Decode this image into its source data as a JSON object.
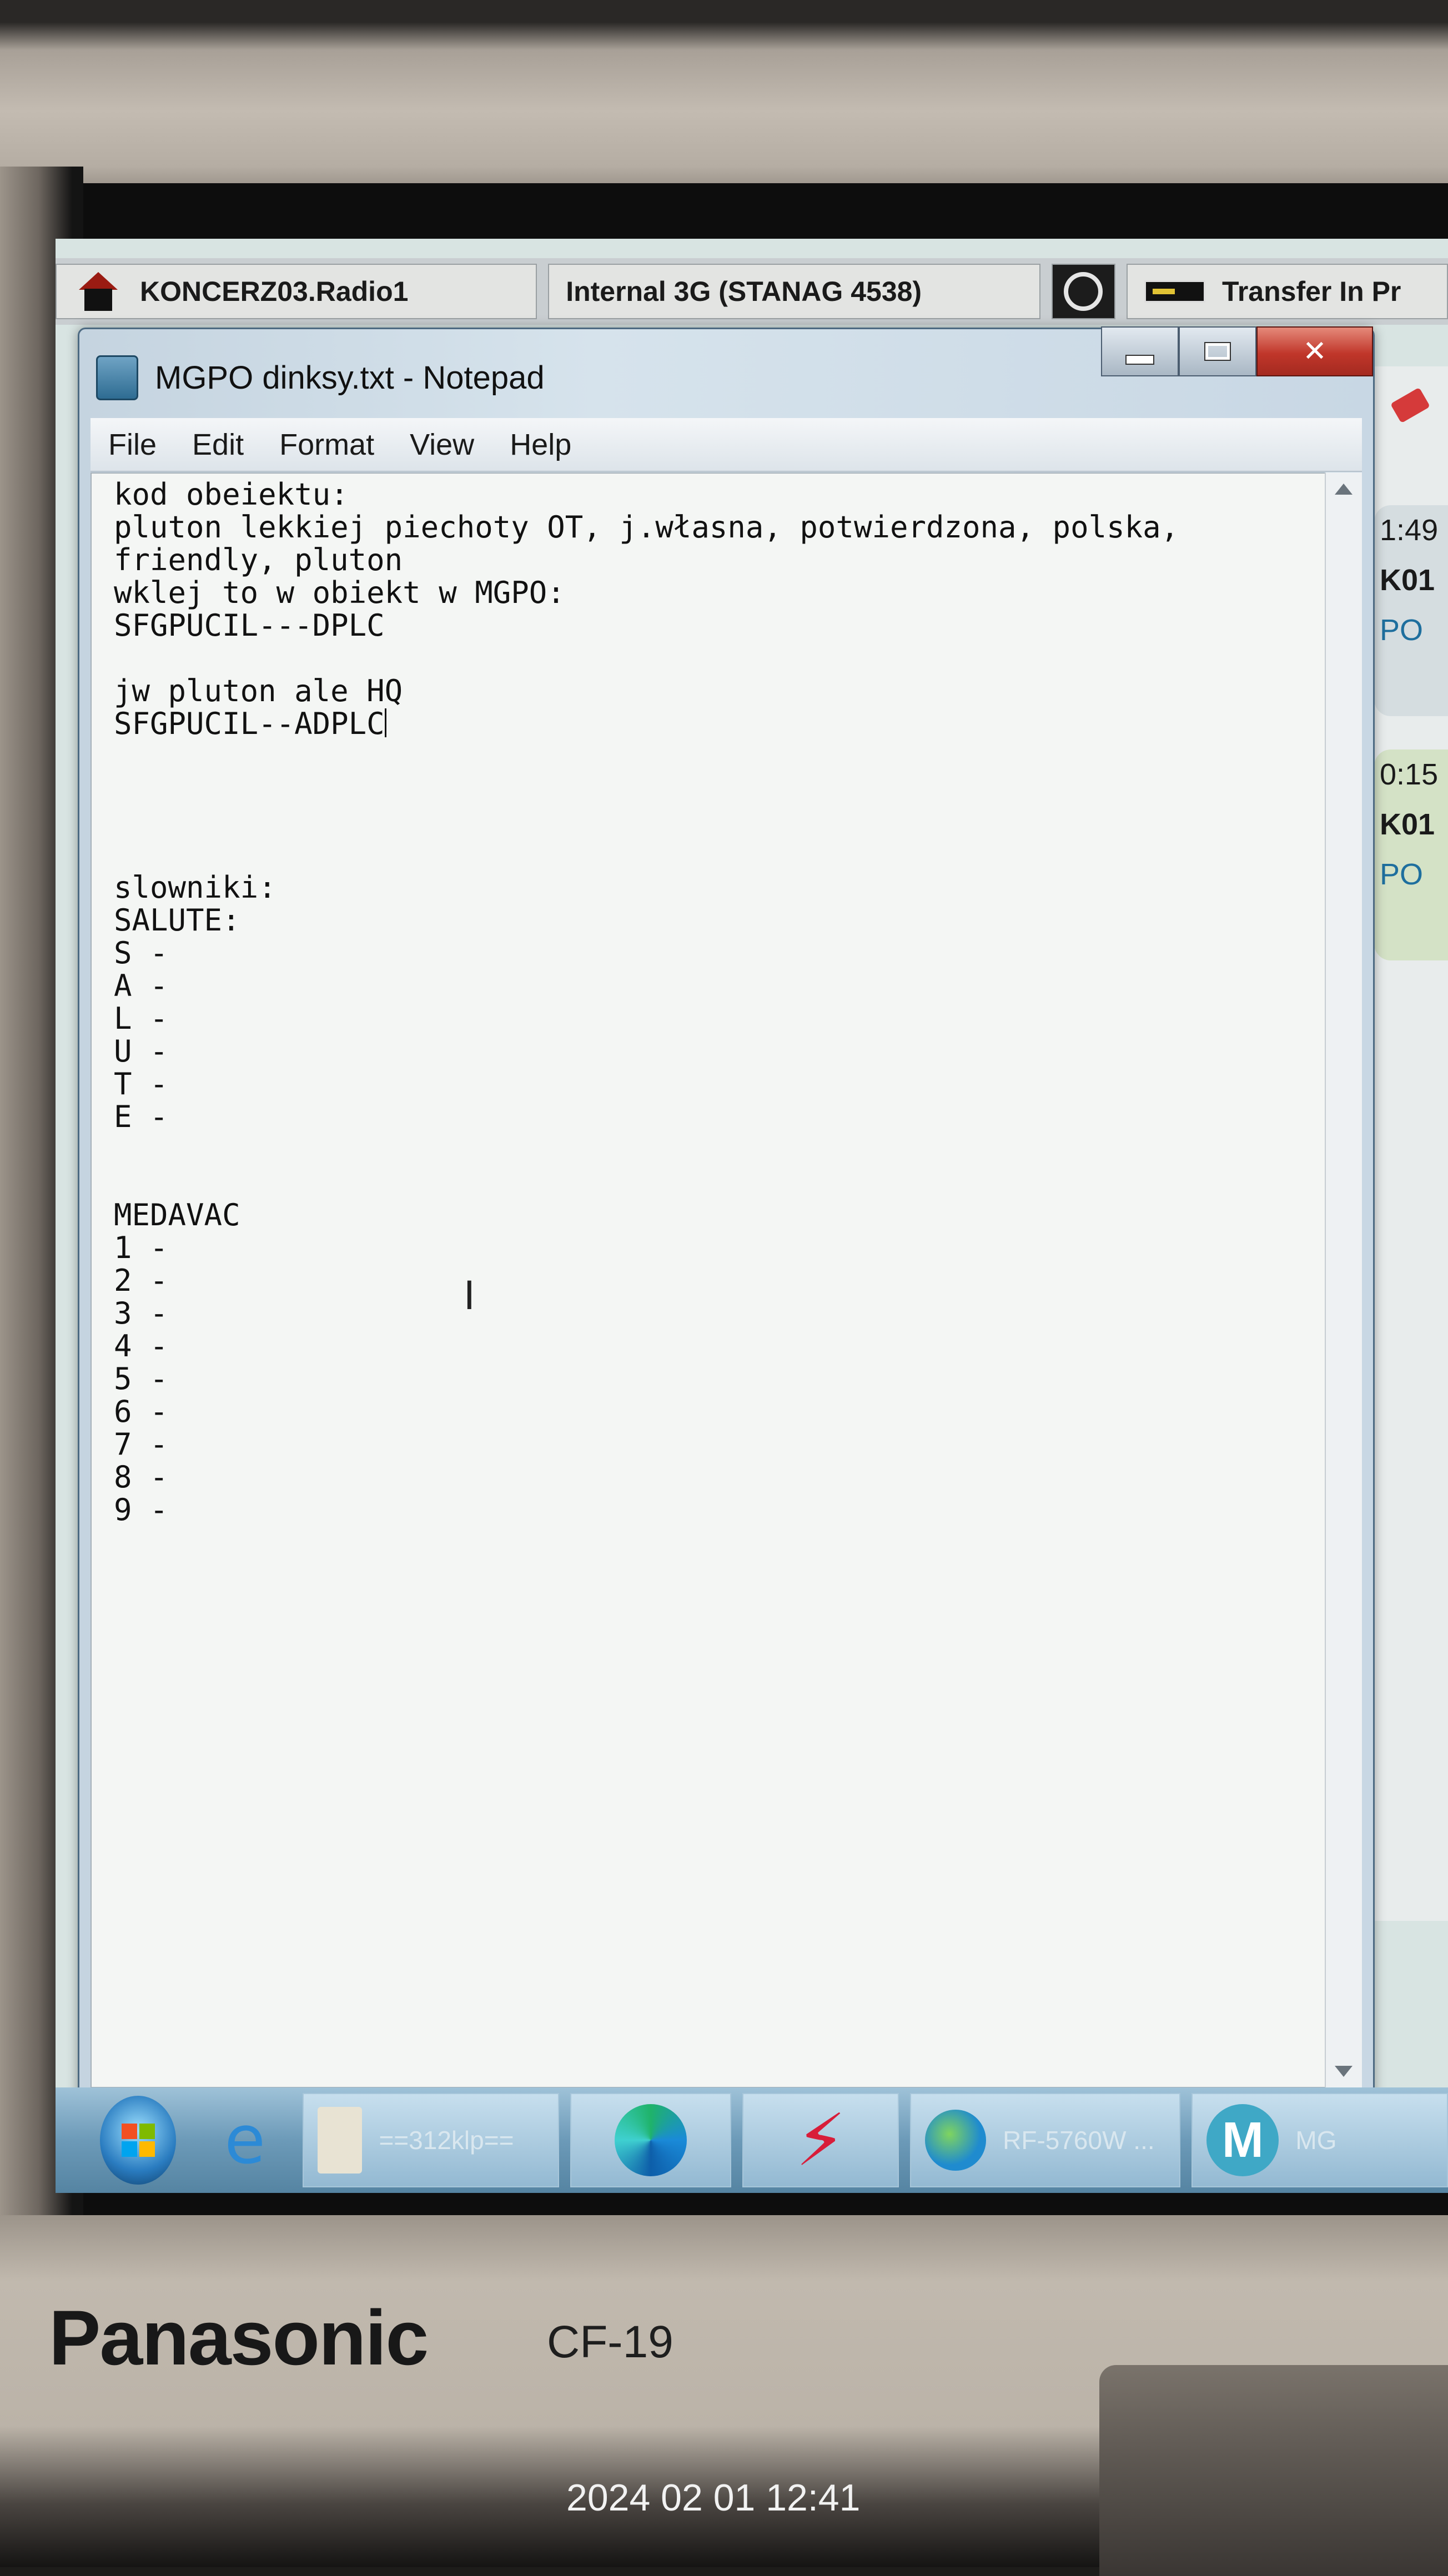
{
  "background_app": {
    "tabs": [
      {
        "label": "KONCERZ03.Radio1",
        "icon": "home-icon"
      },
      {
        "label": "Internal 3G (STANAG 4538)",
        "icon": ""
      },
      {
        "label": "",
        "icon": "ring-icon"
      },
      {
        "label": "Transfer In Pr",
        "icon": "tape-icon"
      }
    ],
    "side_cards": [
      {
        "time": "1:49",
        "id": "K01",
        "name": "PO"
      },
      {
        "time": "0:15",
        "id": "K01",
        "name": "PO"
      }
    ]
  },
  "notepad": {
    "title": "MGPO dinksy.txt - Notepad",
    "menu": [
      "File",
      "Edit",
      "Format",
      "View",
      "Help"
    ],
    "content_before_caret": "kod obeiektu:\npluton lekkiej piechoty OT, j.własna, potwierdzona, polska,\nfriendly, pluton\nwklej to w obiekt w MGPO:\nSFGPUCIL---DPLC\n\njw pluton ale HQ\nSFGPUCIL--ADPLC",
    "content_after_caret": "\n\n\n\n\nslowniki:\nSALUTE:\nS -\nA -\nL -\nU -\nT -\nE -\n\n\nMEDAVAC\n1 -\n2 -\n3 -\n4 -\n5 -\n6 -\n7 -\n8 -\n9 -"
  },
  "taskbar": {
    "items": [
      {
        "label": "",
        "icon": "start-orb-icon"
      },
      {
        "label": "",
        "icon": "internet-explorer-icon"
      },
      {
        "label": "==312klp==",
        "icon": "folder-icon"
      },
      {
        "label": "",
        "icon": "edge-icon"
      },
      {
        "label": "",
        "icon": "bolt-app-icon"
      },
      {
        "label": "RF-5760W ...",
        "icon": "globe-icon"
      },
      {
        "label": "MG",
        "icon": "m-app-icon"
      }
    ]
  },
  "device": {
    "brand": "Panasonic",
    "model": "CF-19",
    "photo_timestamp": "2024 02 01 12:41"
  },
  "colors": {
    "close_button": "#c0362a",
    "taskbar": "#6c9ab8",
    "brand_text": "#181818"
  }
}
